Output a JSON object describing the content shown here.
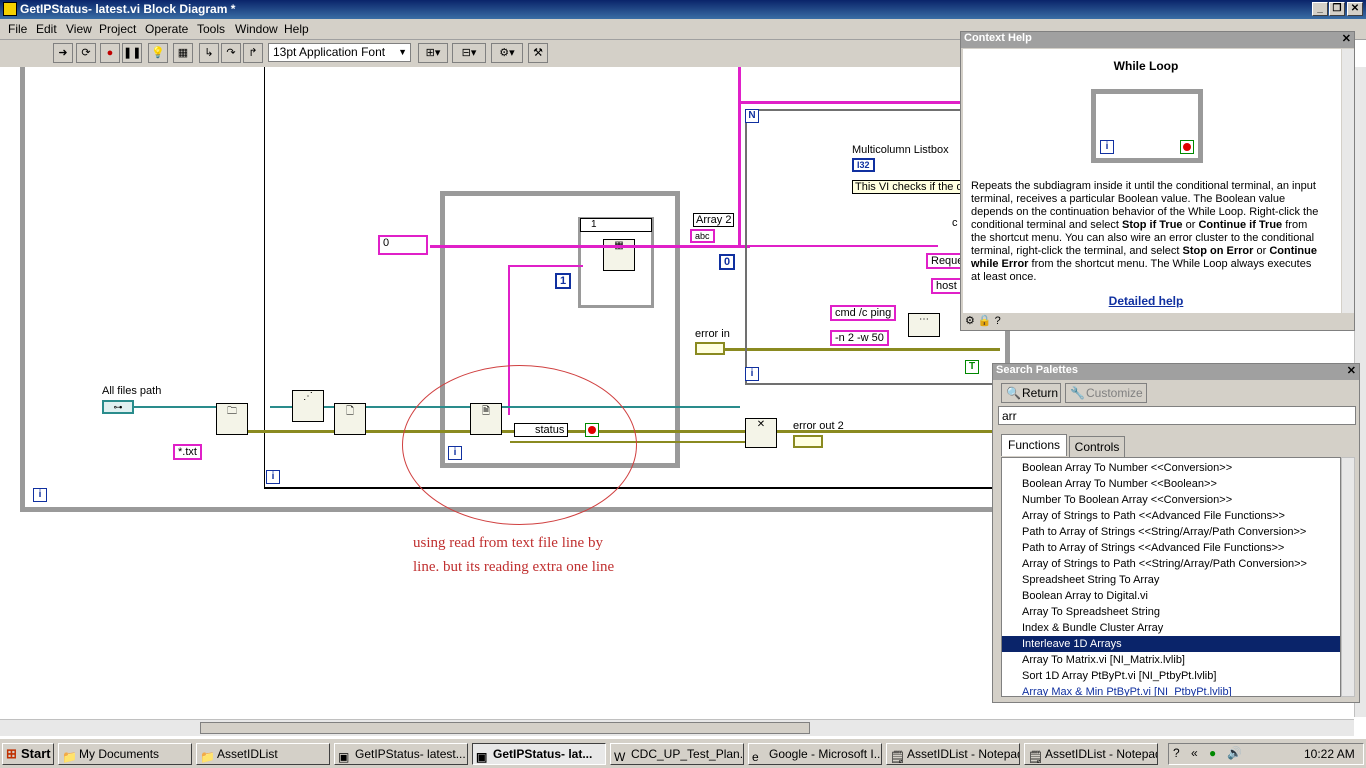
{
  "window": {
    "title": "GetIPStatus- latest.vi Block Diagram *"
  },
  "menu": [
    "File",
    "Edit",
    "View",
    "Project",
    "Operate",
    "Tools",
    "Window",
    "Help"
  ],
  "toolbar": {
    "font_selector": "13pt Application Font"
  },
  "diagram": {
    "labels": {
      "all_files_path": "All files path",
      "txt_constant": "*.txt",
      "zero_constant": "0",
      "one_index": "1",
      "one_const": "1",
      "array2": "Array 2",
      "abc": "abc",
      "status": "status",
      "error_out_2": "error out 2",
      "error_in": "error in",
      "multicolumn_listbox": "Multicolumn Listbox",
      "i32": "I32",
      "vi_checks": "This VI checks if the d",
      "zero_right": "0",
      "n_label": "N",
      "cmd_ping": "cmd /c ping",
      "n2_w50": "-n 2 -w 50",
      "reque": "Reque",
      "host": "host",
      "c_label": "c",
      "t_const": "T",
      "iter": "i"
    },
    "annotation_line1": "using read from text file line by",
    "annotation_line2": "line. but its reading extra one line"
  },
  "context_help": {
    "title": "Context Help",
    "heading": "While Loop",
    "iter_glyph": "i",
    "description_parts": [
      "Repeats the subdiagram inside it until the conditional terminal, an input terminal, receives a particular Boolean value. The Boolean value depends on the continuation behavior of the While Loop. Right-click the conditional terminal and select ",
      "Stop if True",
      " or ",
      "Continue if True",
      " from the shortcut menu. You can also wire an error cluster to the conditional terminal, right-click the terminal, and select ",
      "Stop on Error",
      " or ",
      "Continue while Error",
      " from the shortcut menu. The While Loop always executes at least once."
    ],
    "link": "Detailed help"
  },
  "search_palettes": {
    "title": "Search Palettes",
    "return_button": "Return",
    "customize_button": "Customize",
    "search_value": "arr",
    "tabs": [
      "Functions",
      "Controls"
    ],
    "results": [
      "Boolean Array To Number   <<Conversion>>",
      "Boolean Array To Number   <<Boolean>>",
      "Number To Boolean Array   <<Conversion>>",
      "Array of Strings to Path   <<Advanced File Functions>>",
      "Path to Array of Strings   <<String/Array/Path Conversion>>",
      "Path to Array of Strings   <<Advanced File Functions>>",
      "Array of Strings to Path   <<String/Array/Path Conversion>>",
      "Spreadsheet String To Array",
      "Boolean Array to Digital.vi",
      "Array To Spreadsheet String",
      "Index & Bundle Cluster Array",
      "Interleave 1D Arrays",
      "Array To Matrix.vi [NI_Matrix.lvlib]",
      "Sort 1D Array PtByPt.vi [NI_PtbyPt.lvlib]",
      "Array Max & Min PtByPt.vi [NI_PtbyPt.lvlib]"
    ],
    "selected_index": 11
  },
  "taskbar": {
    "start": "Start",
    "tasks": [
      "My Documents",
      "AssetIDList",
      "GetIPStatus- latest...",
      "GetIPStatus- lat...",
      "CDC_UP_Test_Plan...",
      "Google - Microsoft I...",
      "AssetIDList - Notepad",
      "AssetIDList - Notepad"
    ],
    "active_index": 3,
    "clock": "10:22 AM"
  },
  "colors": {
    "titlebar": "#0a246a",
    "string_wire": "#e020c8",
    "path_wire": "#2a8c8c",
    "error_wire": "#8a8a20",
    "selection": "#0a246a",
    "annotation": "#c03030"
  }
}
